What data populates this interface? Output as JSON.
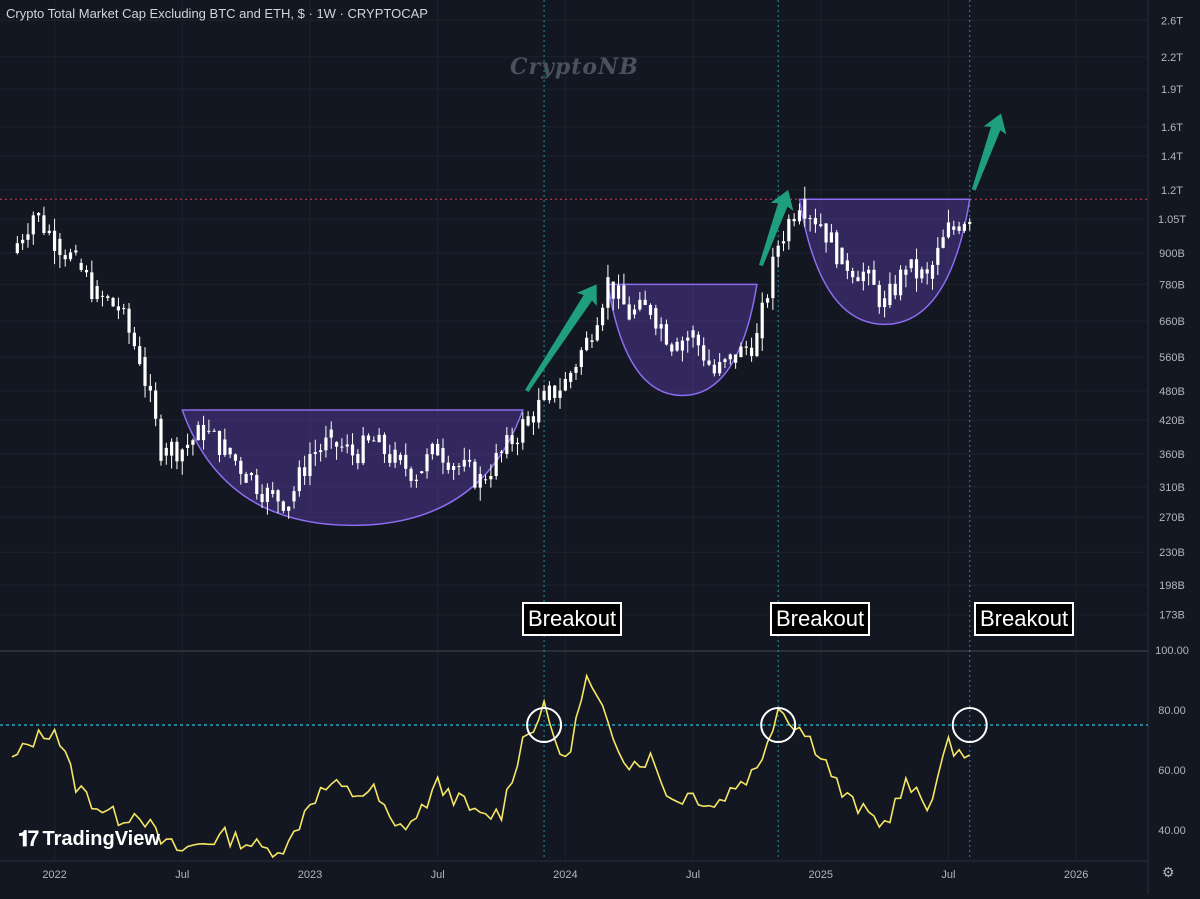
{
  "header": {
    "title": "Crypto Total Market Cap Excluding BTC and ETH, $ · 1W · CRYPTOCAP",
    "watermark": "CryptoNB",
    "brand": "TradingView"
  },
  "annotations": {
    "breakout_labels": [
      "Breakout",
      "Breakout",
      "Breakout"
    ]
  },
  "colors": {
    "background": "#131722",
    "candle": "#ffffff",
    "pattern_fill": "#5b3fa8",
    "pattern_edge": "#8c6cf0",
    "arrow": "#1f9e80",
    "rsi_line": "#f5e663",
    "rsi_level": "#26c6da",
    "resistance": "#e03b5a"
  },
  "chart_data": [
    {
      "type": "line",
      "subtype": "weekly-candlestick",
      "title": "Crypto Total Market Cap Excluding BTC and ETH, $ · 1W · CRYPTOCAP",
      "y_scale": "log",
      "y_ticks": [
        "2.6T",
        "2.2T",
        "1.9T",
        "1.6T",
        "1.4T",
        "1.2T",
        "1.05T",
        "900B",
        "780B",
        "660B",
        "560B",
        "480B",
        "420B",
        "360B",
        "310B",
        "270B",
        "230B",
        "198B",
        "173B"
      ],
      "x_ticks": [
        "2022",
        "Jul",
        "2023",
        "Jul",
        "2024",
        "Jul",
        "2025",
        "Jul",
        "2026"
      ],
      "x_range": [
        "2021-11",
        "2026-03"
      ],
      "x": [
        "2021-11",
        "2021-12",
        "2022-01",
        "2022-02",
        "2022-03",
        "2022-04",
        "2022-05",
        "2022-06",
        "2022-07",
        "2022-08",
        "2022-09",
        "2022-10",
        "2022-11",
        "2022-12",
        "2023-01",
        "2023-02",
        "2023-03",
        "2023-04",
        "2023-05",
        "2023-06",
        "2023-07",
        "2023-08",
        "2023-09",
        "2023-10",
        "2023-11",
        "2023-12",
        "2024-01",
        "2024-02",
        "2024-03",
        "2024-04",
        "2024-05",
        "2024-06",
        "2024-07",
        "2024-08",
        "2024-09",
        "2024-10",
        "2024-11",
        "2024-12",
        "2025-01",
        "2025-02",
        "2025-03",
        "2025-04",
        "2025-05",
        "2025-06",
        "2025-07",
        "2025-08"
      ],
      "close_billions": [
        900,
        1080,
        960,
        860,
        740,
        700,
        560,
        370,
        370,
        400,
        370,
        330,
        300,
        290,
        360,
        380,
        360,
        380,
        350,
        330,
        370,
        340,
        320,
        360,
        410,
        460,
        500,
        600,
        790,
        680,
        700,
        600,
        620,
        520,
        560,
        610,
        940,
        1150,
        1030,
        870,
        820,
        710,
        840,
        800,
        1000,
        1080
      ],
      "resistance_level": "1.15T",
      "patterns": [
        {
          "type": "cup",
          "rim": "440B",
          "bottom": "260B",
          "from": "2022-07",
          "to": "2023-11"
        },
        {
          "type": "cup",
          "rim": "780B",
          "bottom": "470B",
          "from": "2024-03",
          "to": "2024-10"
        },
        {
          "type": "cup",
          "rim": "1.15T",
          "bottom": "650B",
          "from": "2024-12",
          "to": "2025-08"
        }
      ],
      "breakouts": [
        "2023-12",
        "2024-11",
        "2025-08"
      ]
    },
    {
      "type": "line",
      "subtype": "RSI",
      "y_ticks": [
        "100.00",
        "80.00",
        "60.00",
        "40.00"
      ],
      "ylim": [
        30,
        100
      ],
      "level": 75,
      "x": [
        "2021-11",
        "2021-12",
        "2022-01",
        "2022-02",
        "2022-03",
        "2022-04",
        "2022-05",
        "2022-06",
        "2022-07",
        "2022-08",
        "2022-09",
        "2022-10",
        "2022-11",
        "2022-12",
        "2023-01",
        "2023-02",
        "2023-03",
        "2023-04",
        "2023-05",
        "2023-06",
        "2023-07",
        "2023-08",
        "2023-09",
        "2023-10",
        "2023-11",
        "2023-12",
        "2024-01",
        "2024-02",
        "2024-03",
        "2024-04",
        "2024-05",
        "2024-06",
        "2024-07",
        "2024-08",
        "2024-09",
        "2024-10",
        "2024-11",
        "2024-12",
        "2025-01",
        "2025-02",
        "2025-03",
        "2025-04",
        "2025-05",
        "2025-06",
        "2025-07",
        "2025-08"
      ],
      "values": [
        63,
        70,
        74,
        55,
        48,
        44,
        46,
        36,
        33,
        36,
        38,
        36,
        33,
        35,
        50,
        55,
        52,
        53,
        40,
        44,
        55,
        50,
        44,
        46,
        70,
        80,
        62,
        90,
        75,
        62,
        64,
        50,
        52,
        48,
        55,
        60,
        81,
        74,
        66,
        52,
        46,
        42,
        55,
        48,
        68,
        65
      ],
      "circles": [
        "2023-12",
        "2024-11",
        "2025-08"
      ]
    }
  ]
}
